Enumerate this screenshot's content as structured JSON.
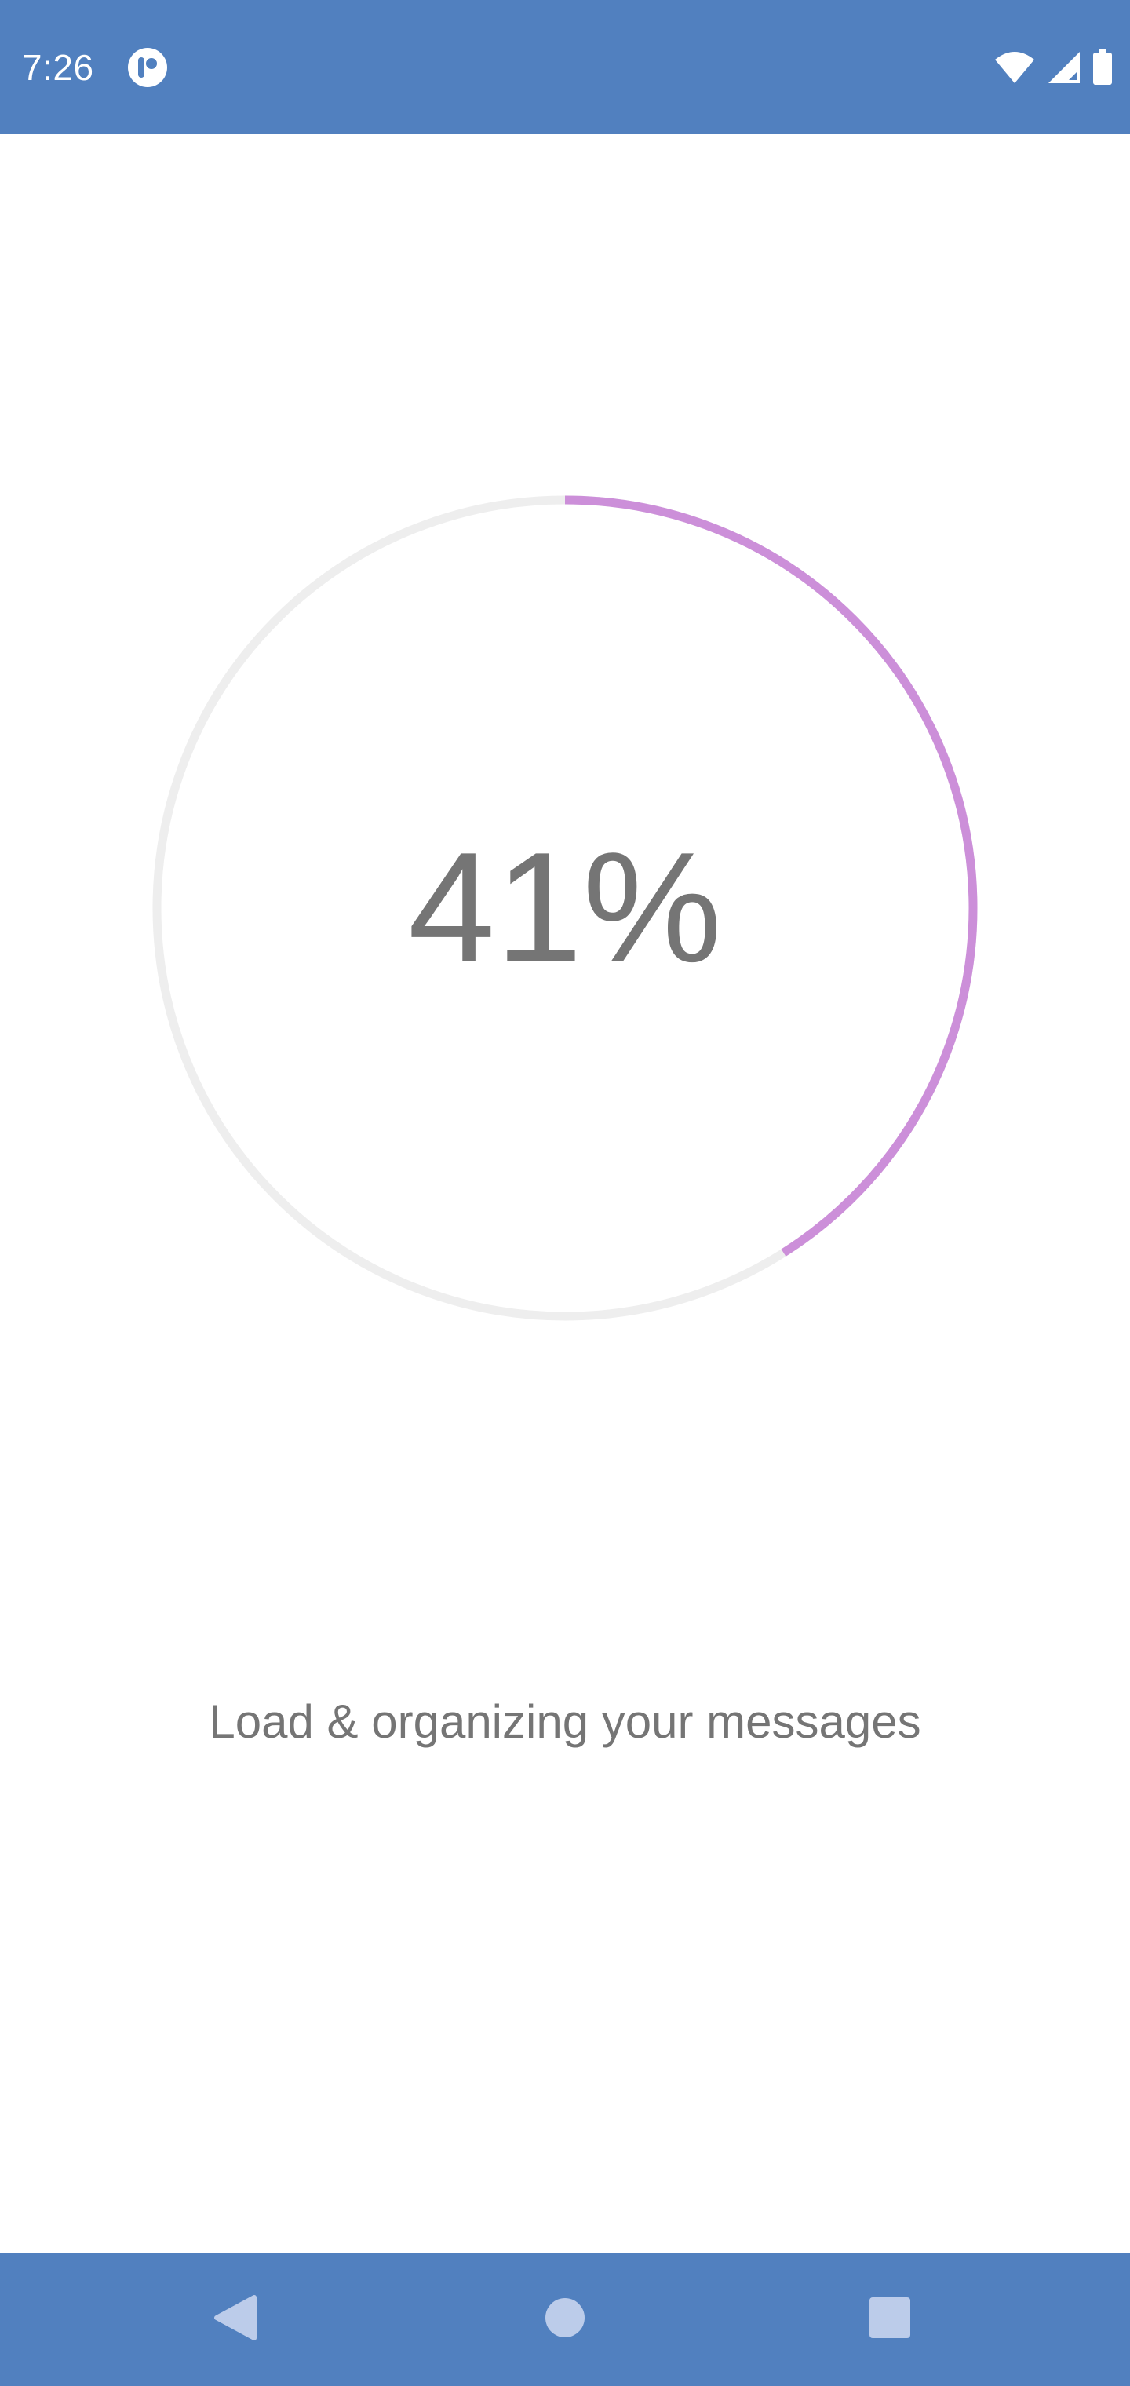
{
  "status_bar": {
    "time": "7:26",
    "app_icon": "app-notification-icon",
    "indicators": [
      "wifi-icon",
      "cell-signal-icon",
      "battery-icon"
    ]
  },
  "progress": {
    "value": 0.41,
    "label": "41%"
  },
  "message": "Load & organizing your messages",
  "navigation": {
    "buttons": [
      "back-icon",
      "home-icon",
      "recents-icon"
    ]
  },
  "colors": {
    "bars": "#5180bf",
    "progress_fill": "#cc8fd9",
    "progress_track": "#eeeeee",
    "text": "#757575",
    "nav_icon": "#bcccea"
  }
}
